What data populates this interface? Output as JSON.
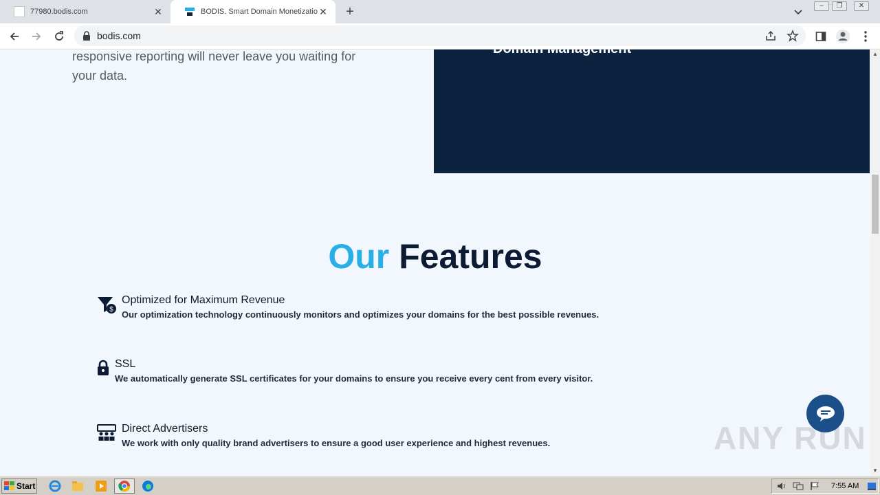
{
  "browser": {
    "tabs": [
      {
        "title": "77980.bodis.com",
        "active": false
      },
      {
        "title": "BODIS. Smart Domain Monetization.",
        "active": true
      }
    ],
    "url": "bodis.com"
  },
  "page": {
    "intro_text": "responsive reporting will never leave you waiting for your data.",
    "panel_title": "Domain Management",
    "features_heading_accent": "Our",
    "features_heading_rest": "Features",
    "features": [
      {
        "icon": "funnel-dollar-icon",
        "title": "Optimized for Maximum Revenue",
        "description": "Our optimization technology continuously monitors and optimizes your domains for the best possible revenues."
      },
      {
        "icon": "lock-icon",
        "title": "SSL",
        "description": "We automatically generate SSL certificates for your domains to ensure you receive every cent from every visitor."
      },
      {
        "icon": "users-icon",
        "title": "Direct Advertisers",
        "description": "We work with only quality brand advertisers to ensure a good user experience and highest revenues."
      }
    ],
    "watermark": "ANY RUN"
  },
  "colors": {
    "accent": "#29aee6",
    "navy": "#0c2340",
    "page_bg": "#f1f7fd"
  },
  "taskbar": {
    "start_label": "Start",
    "clock": "7:55 AM"
  }
}
